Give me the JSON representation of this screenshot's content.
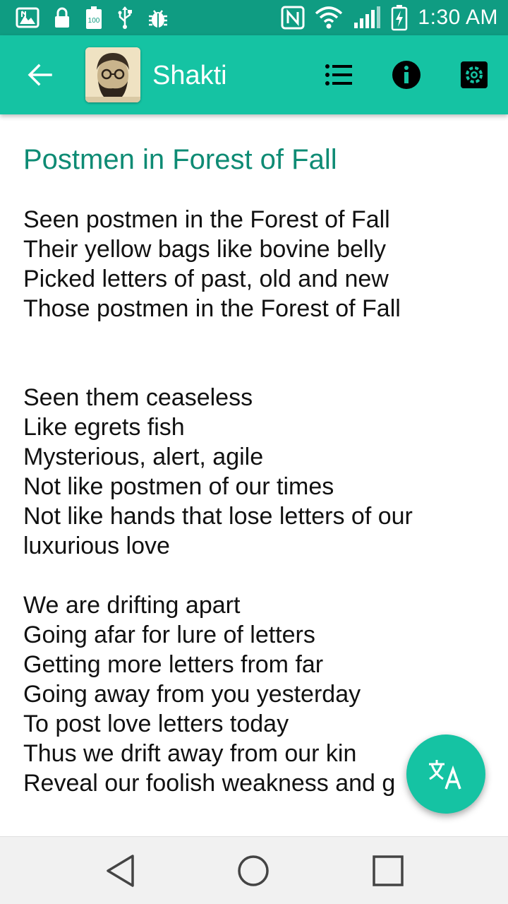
{
  "status_bar": {
    "time": "1:30 AM",
    "battery_label": "100",
    "left_icons": [
      "gallery-icon",
      "lock-icon",
      "battery-100-icon",
      "usb-icon",
      "debug-bug-icon"
    ],
    "right_icons": [
      "nfc-icon",
      "wifi-icon",
      "signal-icon",
      "battery-charging-icon"
    ]
  },
  "app_bar": {
    "title": "Shakti",
    "back_icon": "arrow-back-icon",
    "actions": [
      "list-icon",
      "info-icon",
      "settings-icon"
    ]
  },
  "poem": {
    "title": "Postmen in Forest of Fall",
    "stanzas": [
      {
        "lines": [
          "Seen postmen in the Forest of Fall",
          "Their yellow bags like bovine belly",
          "Picked letters of past, old and new",
          "Those postmen in the Forest of Fall"
        ]
      },
      {
        "lines": [
          "Seen them ceaseless",
          "Like egrets fish",
          "Mysterious, alert, agile",
          "Not like postmen of our times",
          "Not like hands that lose letters of our",
          "luxurious love"
        ]
      },
      {
        "lines": [
          "We are drifting apart",
          "Going afar for lure of letters",
          "Getting more letters from far",
          "Going away from you yesterday",
          "To post love letters today",
          "Thus we drift away from our kin",
          "Reveal our foolish weakness and g"
        ]
      }
    ]
  },
  "fab": {
    "icon": "translate-icon"
  },
  "colors": {
    "status_bar": "#0f9c82",
    "app_bar": "#15c3a3",
    "title_text": "#0e8b74",
    "body_text": "#111111"
  }
}
